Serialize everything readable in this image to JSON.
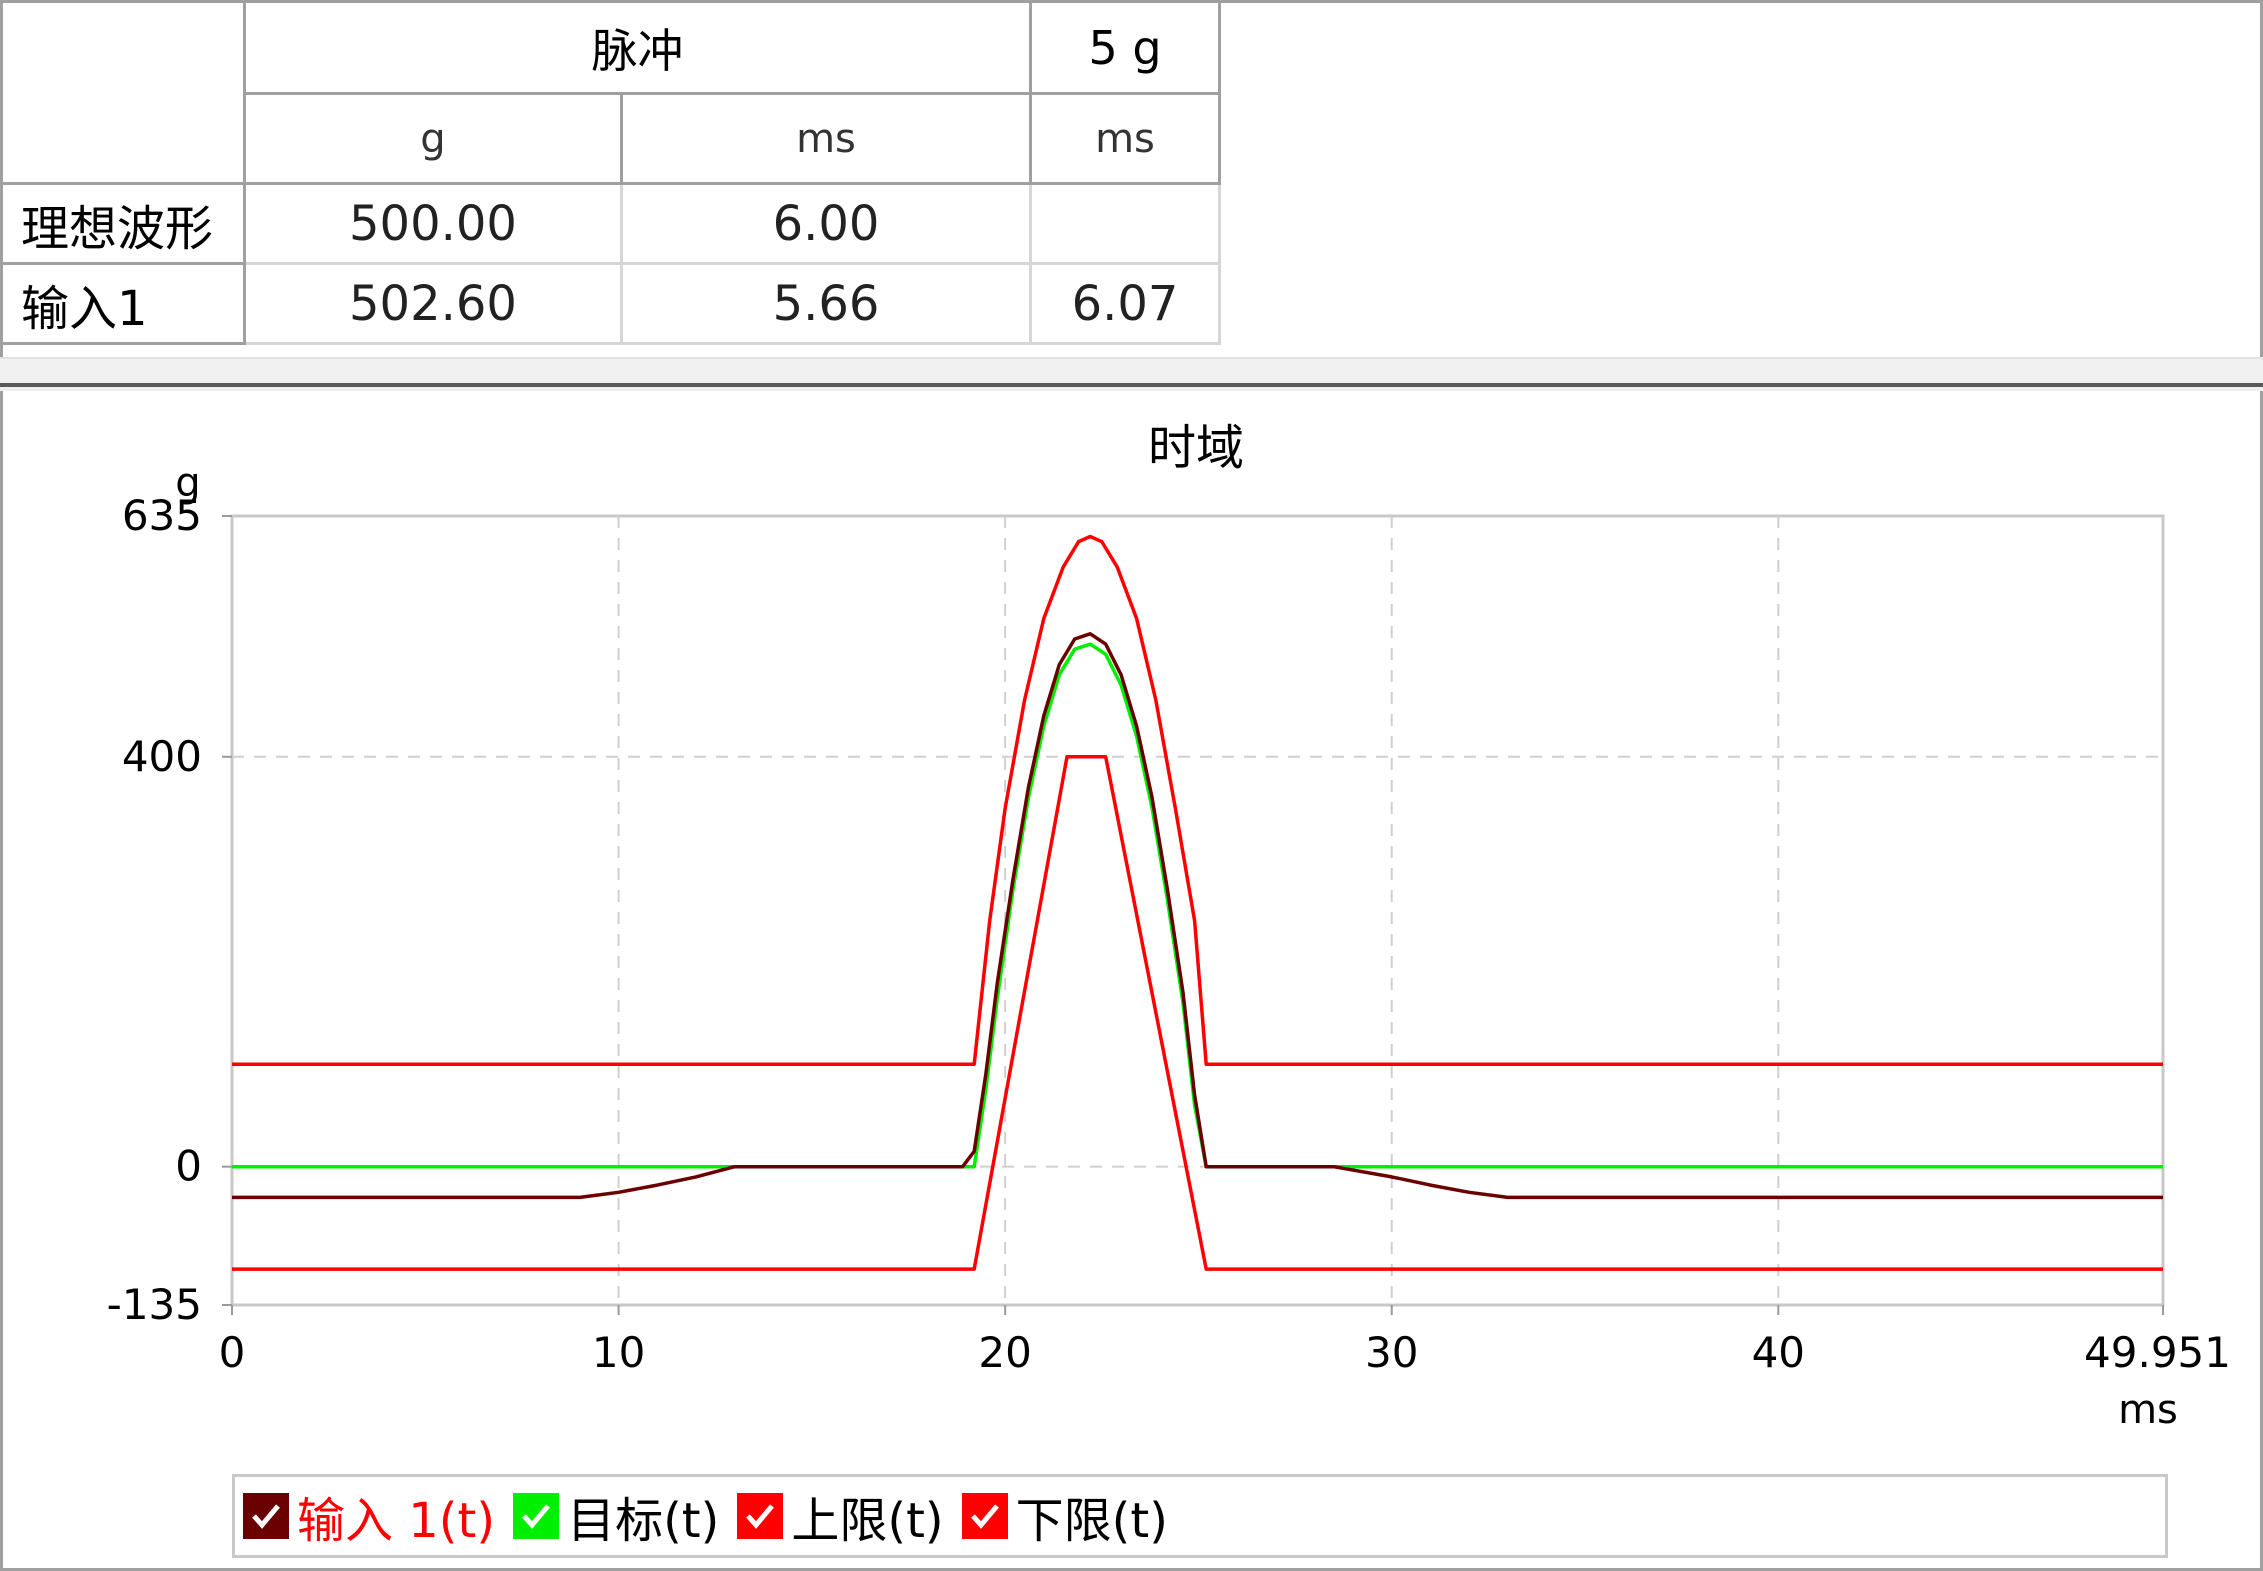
{
  "table": {
    "header_group": "脉冲",
    "header_col3": "5 g",
    "units": [
      "g",
      "ms",
      "ms"
    ],
    "rows": [
      {
        "label": "理想波形",
        "values": [
          "500.00",
          "6.00",
          ""
        ]
      },
      {
        "label": "输入1",
        "values": [
          "502.60",
          "5.66",
          "6.07"
        ]
      }
    ]
  },
  "chart_data": {
    "type": "line",
    "title": "时域",
    "ylabel": "g",
    "xlabel": "ms",
    "xlim": [
      0,
      49.951
    ],
    "ylim": [
      -135,
      635
    ],
    "xticks": [
      "0",
      "10",
      "20",
      "30",
      "40",
      "49.951"
    ],
    "yticks": [
      "635",
      "400",
      "0",
      "-135"
    ],
    "ytick_values": [
      635,
      400,
      0,
      -135
    ],
    "xtick_values": [
      0,
      10,
      20,
      30,
      40,
      49.951
    ],
    "grid": true,
    "series": [
      {
        "name": "输入 1(t)",
        "color": "#6b0000",
        "x": [
          0,
          9,
          10,
          11,
          12,
          13,
          18.9,
          19.2,
          19.5,
          19.8,
          20.2,
          20.6,
          21,
          21.4,
          21.8,
          22.2,
          22.6,
          23,
          23.4,
          23.8,
          24.2,
          24.6,
          24.9,
          25.2,
          25.6,
          28.5,
          30,
          31,
          32,
          33,
          49.951
        ],
        "y": [
          -30,
          -30,
          -25,
          -18,
          -10,
          0,
          0,
          15,
          90,
          180,
          280,
          370,
          440,
          490,
          515,
          520,
          510,
          480,
          430,
          360,
          270,
          170,
          70,
          0,
          0,
          0,
          -10,
          -18,
          -25,
          -30,
          -30
        ]
      },
      {
        "name": "目标(t)",
        "color": "#00ee00",
        "x": [
          0,
          19.2,
          19.5,
          19.8,
          20.2,
          20.6,
          21,
          21.4,
          21.8,
          22.2,
          22.6,
          23,
          23.4,
          23.8,
          24.2,
          24.6,
          24.9,
          25.2,
          49.951
        ],
        "y": [
          0,
          0,
          75,
          165,
          270,
          360,
          430,
          480,
          505,
          510,
          500,
          470,
          420,
          350,
          260,
          160,
          60,
          0,
          0
        ]
      },
      {
        "name": "上限(t)",
        "color": "#ff0000",
        "x": [
          0,
          19.2,
          19.6,
          20.0,
          20.5,
          21.0,
          21.5,
          21.9,
          22.2,
          22.5,
          22.9,
          23.4,
          23.9,
          24.4,
          24.9,
          25.2,
          49.951
        ],
        "y": [
          100,
          100,
          240,
          350,
          455,
          535,
          585,
          610,
          615,
          610,
          585,
          535,
          455,
          350,
          240,
          100,
          100
        ]
      },
      {
        "name": "下限(t)",
        "color": "#ff0000",
        "x": [
          0,
          19.2,
          21.6,
          22.6,
          25.2,
          49.951
        ],
        "y": [
          -100,
          -100,
          400,
          400,
          -100,
          -100
        ]
      }
    ],
    "legend": [
      "输入 1(t)",
      "目标(t)",
      "上限(t)",
      "下限(t)"
    ],
    "legend_position": "bottom"
  }
}
